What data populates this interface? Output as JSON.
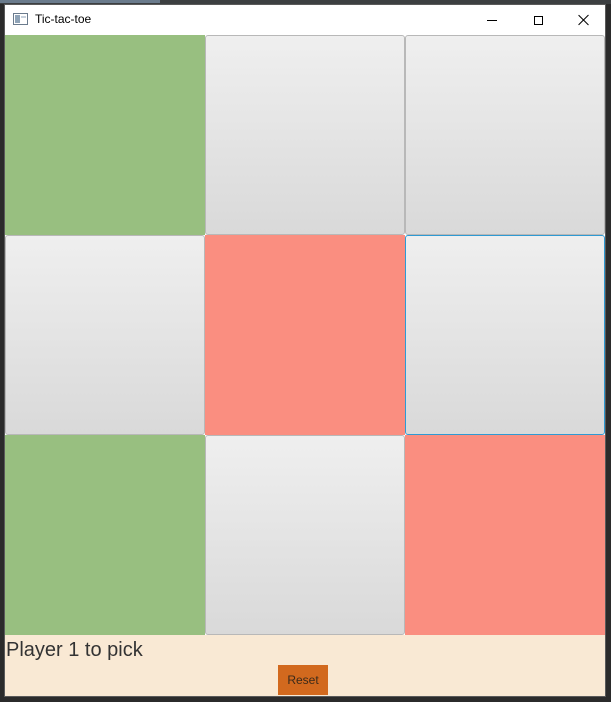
{
  "window": {
    "title": "Tic-tac-toe"
  },
  "board": {
    "cells": [
      {
        "owner": "player1",
        "focused": false
      },
      {
        "owner": "none",
        "focused": false
      },
      {
        "owner": "none",
        "focused": false
      },
      {
        "owner": "none",
        "focused": false
      },
      {
        "owner": "player2",
        "focused": false
      },
      {
        "owner": "none",
        "focused": true
      },
      {
        "owner": "player1",
        "focused": false
      },
      {
        "owner": "none",
        "focused": false
      },
      {
        "owner": "player2",
        "focused": false
      }
    ]
  },
  "status": {
    "text": "Player 1 to pick"
  },
  "controls": {
    "reset_label": "Reset"
  },
  "colors": {
    "player1": "#98bf80",
    "player2": "#fa8e80",
    "empty_gradient_top": "#efefef",
    "empty_gradient_bottom": "#d9d9d9",
    "focus_border": "#2f9ad3",
    "bottom_bar": "#f9e9d4",
    "reset_button": "#d2691e"
  },
  "icons": {
    "app": "window-app-icon",
    "minimize": "minimize-icon",
    "maximize": "maximize-icon",
    "close": "close-icon"
  }
}
